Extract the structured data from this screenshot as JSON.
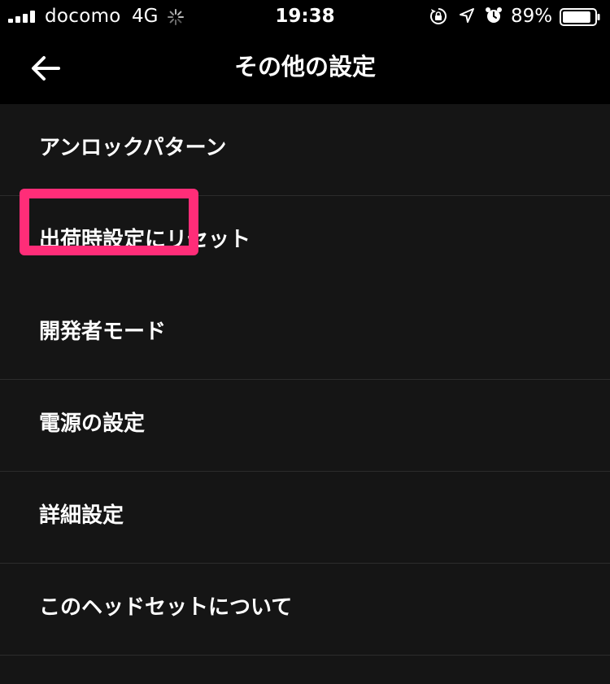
{
  "status_bar": {
    "carrier": "docomo",
    "network": "4G",
    "time": "19:38",
    "battery_percent": "89%",
    "battery_level": 0.89,
    "icons": [
      "signal-icon",
      "loading-spinner-icon",
      "rotation-lock-icon",
      "location-arrow-icon",
      "alarm-clock-icon",
      "battery-icon"
    ]
  },
  "nav": {
    "title": "その他の設定",
    "back_icon": "arrow-left-icon"
  },
  "menu": {
    "items": [
      {
        "label": "アンロックパターン"
      },
      {
        "label": "出荷時設定にリセット"
      },
      {
        "label": "開発者モード"
      },
      {
        "label": "電源の設定"
      },
      {
        "label": "詳細設定"
      },
      {
        "label": "このヘッドセットについて"
      }
    ],
    "highlighted_index": 2
  },
  "colors": {
    "background": "#151515",
    "top_bar": "#000000",
    "divider": "#2c2c2c",
    "highlight": "#ff2d78",
    "text": "#ffffff"
  }
}
